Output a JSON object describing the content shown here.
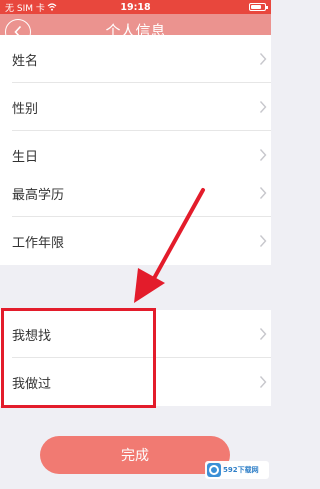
{
  "status_bar": {
    "carrier": "无 SIM 卡",
    "time": "19:18",
    "battery_level": 0.75
  },
  "nav": {
    "title": "个人信息",
    "back_icon": "chevron-left-icon"
  },
  "groups": [
    {
      "items": [
        {
          "label": "姓名"
        },
        {
          "label": "性别"
        },
        {
          "label": "生日"
        }
      ]
    },
    {
      "items": [
        {
          "label": "最高学历"
        },
        {
          "label": "工作年限"
        }
      ]
    },
    {
      "items": [
        {
          "label": "我想找"
        },
        {
          "label": "我做过"
        }
      ]
    }
  ],
  "done_button": {
    "label": "完成"
  },
  "watermark": {
    "text": "592下载网"
  },
  "colors": {
    "brand": "#e8473d",
    "annotation": "#e31c2b",
    "button": "#f26e64"
  }
}
